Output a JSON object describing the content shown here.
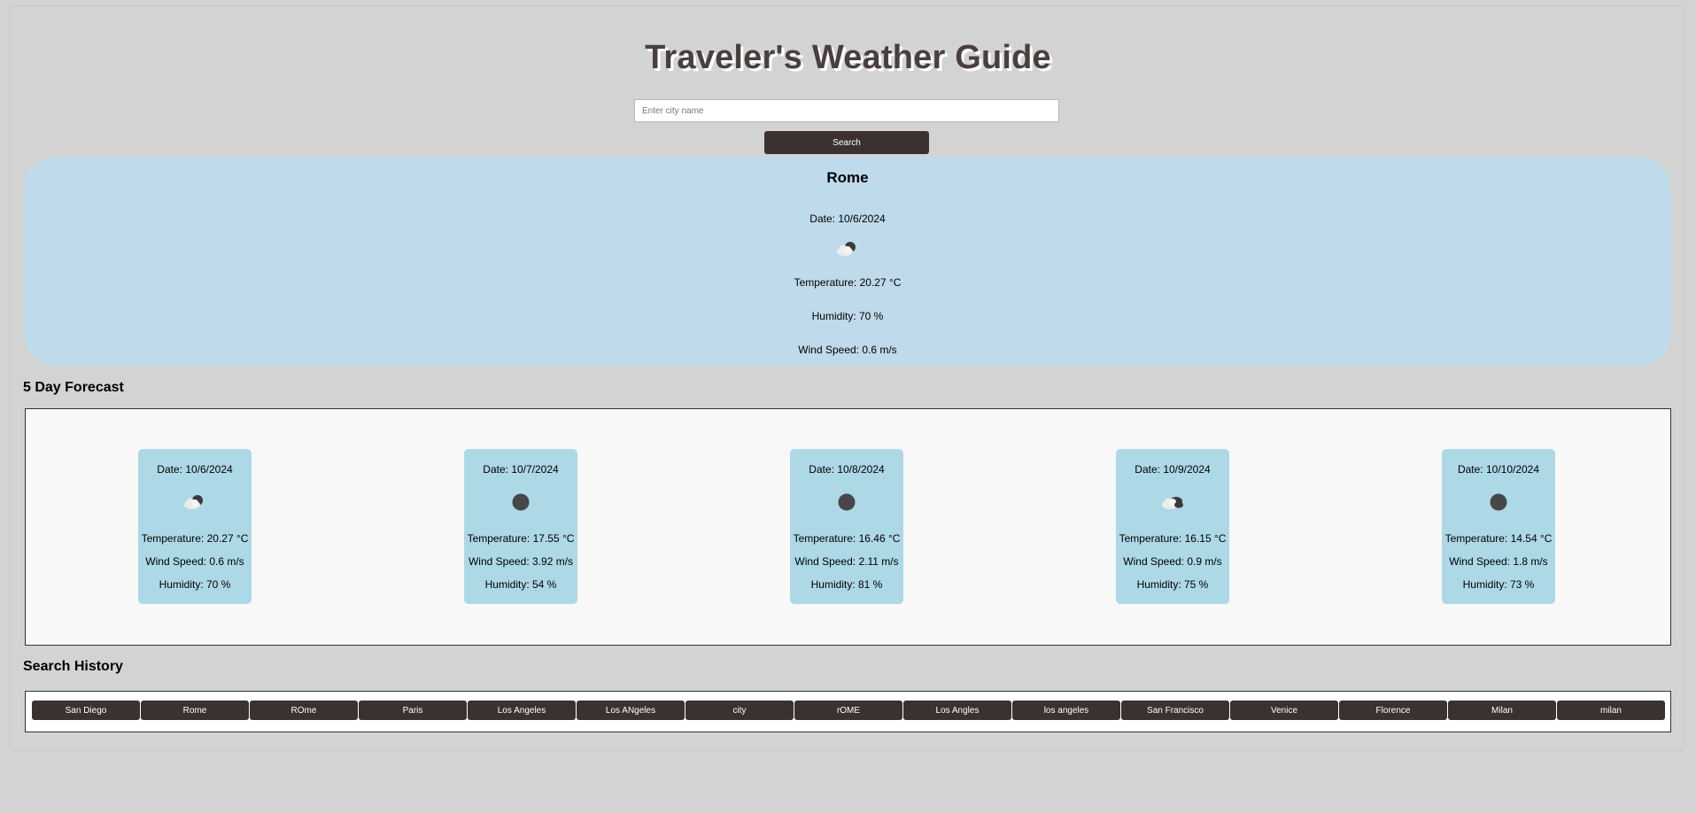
{
  "header": {
    "title": "Traveler's Weather Guide"
  },
  "search": {
    "placeholder": "Enter city name",
    "value": "",
    "button_label": "Search"
  },
  "current": {
    "city": "Rome",
    "date": "Date: 10/6/2024",
    "icon": "partly-cloudy-icon",
    "temperature": "Temperature: 20.27 °C",
    "humidity": "Humidity: 70 %",
    "wind": "Wind Speed: 0.6 m/s"
  },
  "forecast": {
    "title": "5 Day Forecast",
    "days": [
      {
        "date": "Date: 10/6/2024",
        "icon": "partly-cloudy-icon",
        "temperature": "Temperature: 20.27 °C",
        "wind": "Wind Speed: 0.6 m/s",
        "humidity": "Humidity: 70 %"
      },
      {
        "date": "Date: 10/7/2024",
        "icon": "overcast-dot-icon",
        "temperature": "Temperature: 17.55 °C",
        "wind": "Wind Speed: 3.92 m/s",
        "humidity": "Humidity: 54 %"
      },
      {
        "date": "Date: 10/8/2024",
        "icon": "overcast-dot-icon",
        "temperature": "Temperature: 16.46 °C",
        "wind": "Wind Speed: 2.11 m/s",
        "humidity": "Humidity: 81 %"
      },
      {
        "date": "Date: 10/9/2024",
        "icon": "broken-clouds-icon",
        "temperature": "Temperature: 16.15 °C",
        "wind": "Wind Speed: 0.9 m/s",
        "humidity": "Humidity: 75 %"
      },
      {
        "date": "Date: 10/10/2024",
        "icon": "overcast-dot-icon",
        "temperature": "Temperature: 14.54 °C",
        "wind": "Wind Speed: 1.8 m/s",
        "humidity": "Humidity: 73 %"
      }
    ]
  },
  "history": {
    "title": "Search History",
    "items": [
      "San Diego",
      "Rome",
      "ROme",
      "Paris",
      "Los Angeles",
      "Los ANgeles",
      "city",
      "rOME",
      "Los Angles",
      "los angeles",
      "San Francisco",
      "Venice",
      "Florence",
      "Milan",
      "milan"
    ]
  },
  "colors": {
    "page_bg": "#d3d3d3",
    "current_panel_bg": "#bfdaea",
    "card_bg": "#add8e6",
    "button_bg": "#3b3131",
    "title_color": "#4a3f3f"
  }
}
